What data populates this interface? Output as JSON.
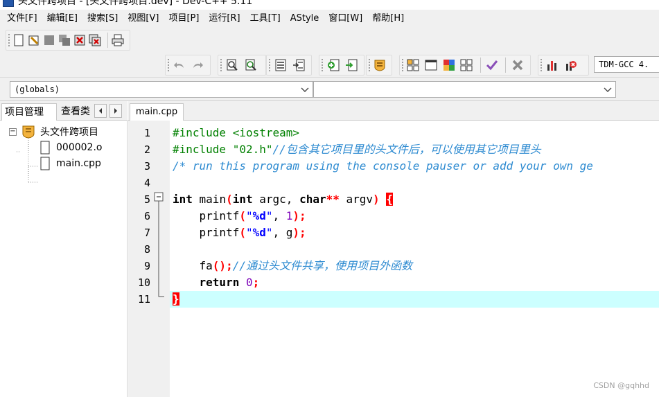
{
  "window": {
    "title": "头文件跨项目 - [头文件跨项目.dev] - Dev-C++ 5.11"
  },
  "menu": [
    "文件[F]",
    "编辑[E]",
    "搜索[S]",
    "视图[V]",
    "项目[P]",
    "运行[R]",
    "工具[T]",
    "AStyle",
    "窗口[W]",
    "帮助[H]"
  ],
  "toolbar": {
    "compiler": "TDM-GCC 4."
  },
  "class_browser": {
    "scope": "(globals)",
    "member": ""
  },
  "left_panel": {
    "tabs": [
      "项目管理",
      "查看类"
    ],
    "project": "头文件跨项目",
    "files": [
      "000002.o",
      "main.cpp"
    ]
  },
  "editor": {
    "tab": "main.cpp",
    "current_line": 11,
    "lines": [
      {
        "n": "1",
        "tokens": [
          {
            "t": "#include <iostream>",
            "c": "pre"
          }
        ]
      },
      {
        "n": "2",
        "tokens": [
          {
            "t": "#include \"02.h\"",
            "c": "pre"
          },
          {
            "t": "//包含其它项目里的头文件后，可以使用其它项目里头",
            "c": "comment"
          }
        ]
      },
      {
        "n": "3",
        "tokens": [
          {
            "t": "/* run this program using the console pauser or add your own ge",
            "c": "comment"
          }
        ]
      },
      {
        "n": "4",
        "tokens": []
      },
      {
        "n": "5",
        "tokens": [
          {
            "t": "int",
            "c": "kw"
          },
          {
            "t": " main",
            "c": "plain"
          },
          {
            "t": "(",
            "c": "sym"
          },
          {
            "t": "int",
            "c": "kw"
          },
          {
            "t": " argc, ",
            "c": "plain"
          },
          {
            "t": "char",
            "c": "kw"
          },
          {
            "t": "**",
            "c": "sym"
          },
          {
            "t": " argv",
            "c": "plain"
          },
          {
            "t": ")",
            "c": "sym"
          },
          {
            "t": " ",
            "c": "plain"
          },
          {
            "t": "{",
            "c": "brace"
          }
        ]
      },
      {
        "n": "6",
        "tokens": [
          {
            "t": "    printf",
            "c": "plain"
          },
          {
            "t": "(",
            "c": "sym"
          },
          {
            "t": "\"",
            "c": "str"
          },
          {
            "t": "%d",
            "c": "strfmt"
          },
          {
            "t": "\"",
            "c": "str"
          },
          {
            "t": ", ",
            "c": "plain"
          },
          {
            "t": "1",
            "c": "num"
          },
          {
            "t": ");",
            "c": "sym"
          }
        ]
      },
      {
        "n": "7",
        "tokens": [
          {
            "t": "    printf",
            "c": "plain"
          },
          {
            "t": "(",
            "c": "sym"
          },
          {
            "t": "\"",
            "c": "str"
          },
          {
            "t": "%d",
            "c": "strfmt"
          },
          {
            "t": "\"",
            "c": "str"
          },
          {
            "t": ", g",
            "c": "plain"
          },
          {
            "t": ");",
            "c": "sym"
          }
        ]
      },
      {
        "n": "8",
        "tokens": []
      },
      {
        "n": "9",
        "tokens": [
          {
            "t": "    fa",
            "c": "plain"
          },
          {
            "t": "();",
            "c": "sym"
          },
          {
            "t": "//通过头文件共享，使用项目外函数",
            "c": "comment"
          }
        ]
      },
      {
        "n": "10",
        "tokens": [
          {
            "t": "    ",
            "c": "plain"
          },
          {
            "t": "return",
            "c": "kw"
          },
          {
            "t": " ",
            "c": "plain"
          },
          {
            "t": "0",
            "c": "num"
          },
          {
            "t": ";",
            "c": "sym"
          }
        ]
      },
      {
        "n": "11",
        "tokens": [
          {
            "t": "}",
            "c": "brace"
          }
        ]
      }
    ]
  },
  "watermark": "CSDN @gqhhd"
}
